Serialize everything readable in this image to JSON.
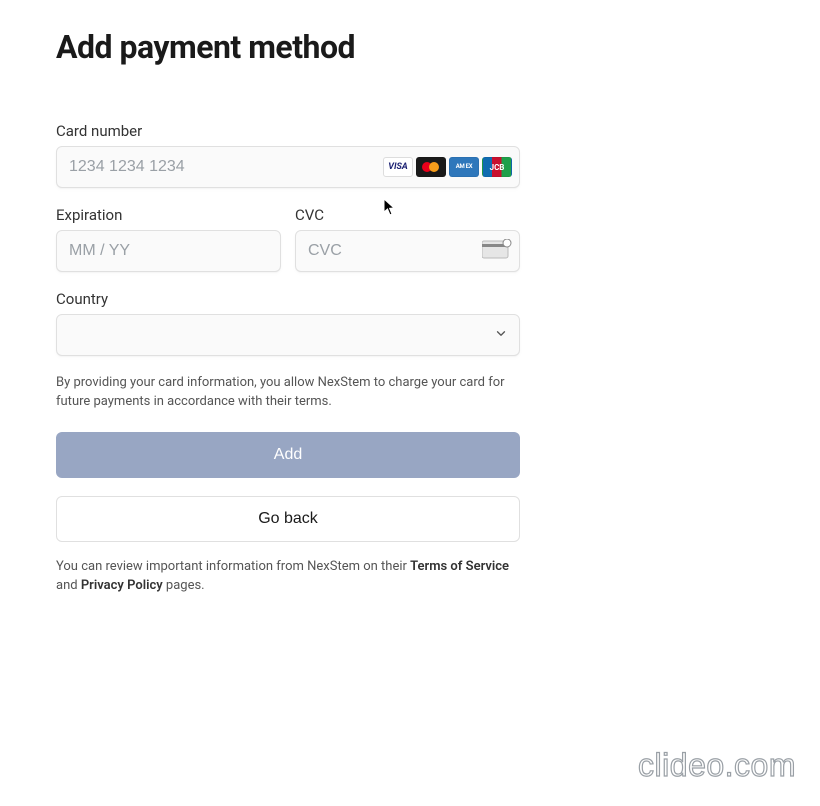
{
  "title": "Add payment method",
  "card": {
    "label": "Card number",
    "placeholder": "1234 1234 1234",
    "value": ""
  },
  "expiration": {
    "label": "Expiration",
    "placeholder": "MM / YY",
    "value": ""
  },
  "cvc": {
    "label": "CVC",
    "placeholder": "CVC",
    "value": ""
  },
  "country": {
    "label": "Country",
    "value": ""
  },
  "brands": {
    "visa": "VISA",
    "amex": "AM\nEX",
    "jcb": "JCB"
  },
  "disclosure": "By providing your card information, you allow NexStem to charge your card for future payments in accordance with their terms.",
  "buttons": {
    "add": "Add",
    "back": "Go back"
  },
  "legal": {
    "prefix": "You can review important information from NexStem on their ",
    "tos": "Terms of Service",
    "conj": " and ",
    "privacy": "Privacy Policy",
    "suffix": " pages."
  },
  "watermark": "clideo.com"
}
